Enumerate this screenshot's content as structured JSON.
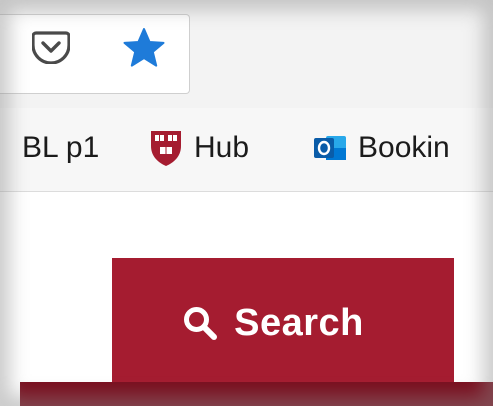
{
  "toolbar": {
    "pocket_icon": "pocket-icon",
    "bookmark_star_icon": "star-icon",
    "star_color": "#1e7bd9"
  },
  "bookmarks": [
    {
      "label": "BL p1",
      "icon": "none"
    },
    {
      "label": "Hub",
      "icon": "harvard-shield-icon"
    },
    {
      "label": "Bookin",
      "icon": "outlook-icon"
    }
  ],
  "page": {
    "search_button_label": "Search",
    "search_icon": "search-icon",
    "accent_color": "#a51c30"
  }
}
